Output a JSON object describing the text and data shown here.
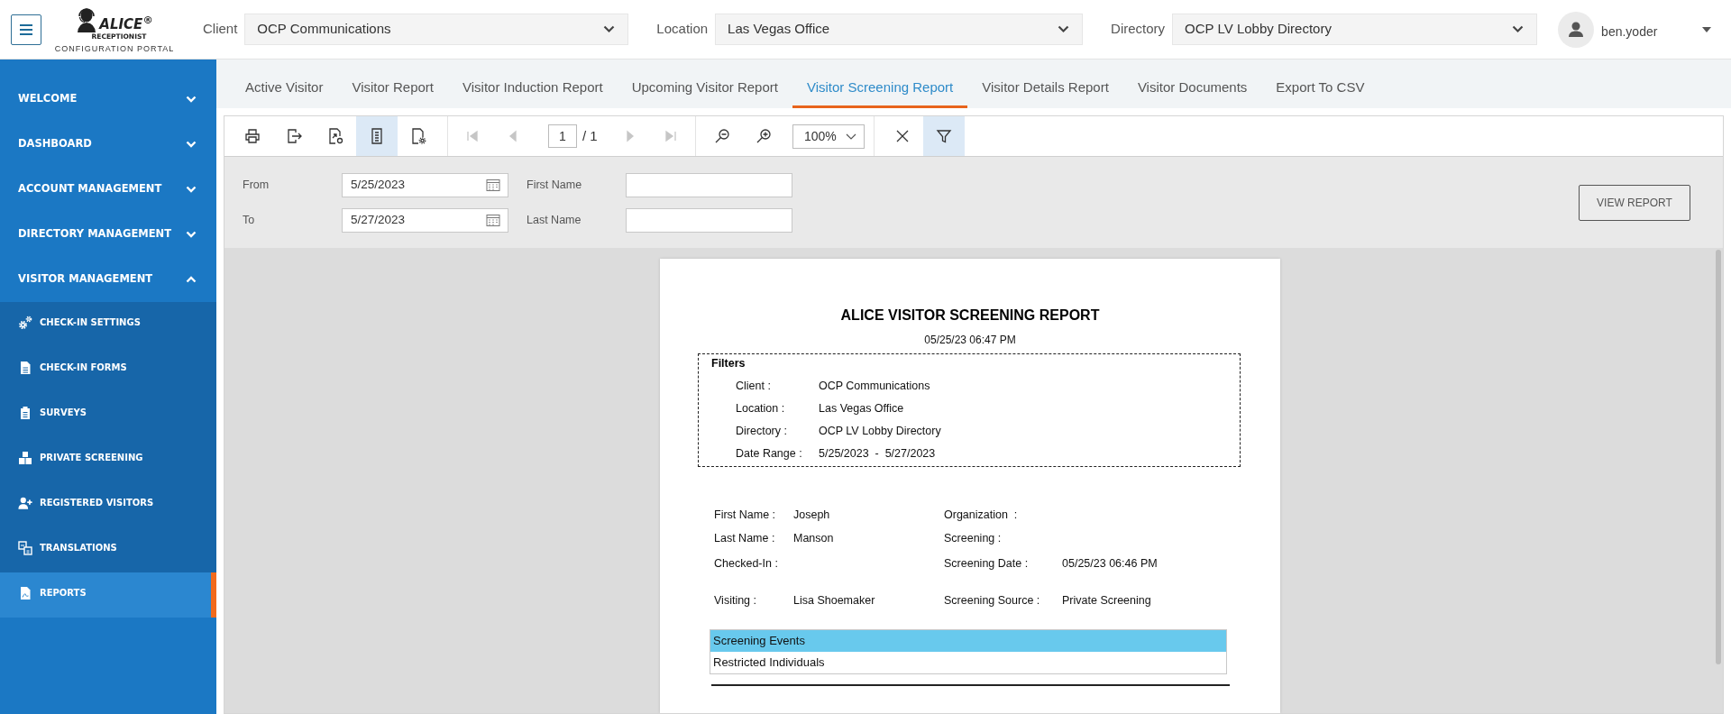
{
  "header": {
    "logo": {
      "wordmark": "ALICE$^{®}$",
      "tagline": "RECEPTIONIST",
      "caption": "CONFIGURATION PORTAL"
    },
    "selectors": [
      {
        "label": "Client",
        "value": "OCP Communications"
      },
      {
        "label": "Location",
        "value": "Las Vegas Office"
      },
      {
        "label": "Directory",
        "value": "OCP LV Lobby Directory"
      }
    ],
    "user": {
      "name": "ben.yoder"
    }
  },
  "sidebar": {
    "items": [
      {
        "label": "WELCOME",
        "expanded": false
      },
      {
        "label": "DASHBOARD",
        "expanded": false
      },
      {
        "label": "ACCOUNT MANAGEMENT",
        "expanded": false
      },
      {
        "label": "DIRECTORY MANAGEMENT",
        "expanded": false
      },
      {
        "label": "VISITOR MANAGEMENT",
        "expanded": true,
        "children": [
          {
            "label": "CHECK-IN SETTINGS",
            "selected": false
          },
          {
            "label": "CHECK-IN FORMS",
            "selected": false
          },
          {
            "label": "SURVEYS",
            "selected": false
          },
          {
            "label": "PRIVATE SCREENING",
            "selected": false
          },
          {
            "label": "REGISTERED VISITORS",
            "selected": false
          },
          {
            "label": "TRANSLATIONS",
            "selected": false
          },
          {
            "label": "REPORTS",
            "selected": true
          }
        ]
      }
    ]
  },
  "tabs": [
    {
      "label": "Active Visitor",
      "selected": false
    },
    {
      "label": "Visitor Report",
      "selected": false
    },
    {
      "label": "Visitor Induction Report",
      "selected": false
    },
    {
      "label": "Upcoming Visitor Report",
      "selected": false
    },
    {
      "label": "Visitor Screening Report",
      "selected": true
    },
    {
      "label": "Visitor Details Report",
      "selected": false
    },
    {
      "label": "Visitor Documents",
      "selected": false
    },
    {
      "label": "Export To CSV",
      "selected": false
    }
  ],
  "toolbar": {
    "groups": [
      {
        "items": [
          {
            "kind": "button",
            "on": false,
            "disabled": false
          },
          {
            "kind": "button",
            "on": false,
            "disabled": false
          },
          {
            "kind": "button",
            "on": false,
            "disabled": false
          },
          {
            "kind": "button",
            "on": true,
            "disabled": false
          },
          {
            "kind": "button",
            "on": false,
            "disabled": false
          }
        ]
      },
      {
        "items": [
          {
            "kind": "button",
            "on": false,
            "disabled": true
          },
          {
            "kind": "button",
            "on": false,
            "disabled": true
          },
          {
            "kind": "page",
            "value": "1",
            "total": "/ 1"
          },
          {
            "kind": "button",
            "on": false,
            "disabled": true
          },
          {
            "kind": "button",
            "on": false,
            "disabled": true
          }
        ]
      },
      {
        "items": [
          {
            "kind": "button",
            "on": false,
            "disabled": false
          },
          {
            "kind": "button",
            "on": false,
            "disabled": false
          },
          {
            "kind": "zoom",
            "value": "100%"
          }
        ]
      },
      {
        "items": [
          {
            "kind": "button",
            "on": false,
            "disabled": false
          },
          {
            "kind": "button",
            "on": true,
            "disabled": false
          }
        ]
      }
    ]
  },
  "parameters": {
    "columns": [
      {
        "fields": [
          {
            "kind": "date",
            "label": "From",
            "value": "5/25/2023"
          },
          {
            "kind": "date",
            "label": "To",
            "value": "5/27/2023"
          }
        ]
      },
      {
        "fields": [
          {
            "kind": "text",
            "label": "First Name"
          },
          {
            "kind": "text",
            "label": "Last Name"
          }
        ]
      }
    ],
    "button": "VIEW REPORT"
  },
  "report": {
    "title": "ALICE VISITOR SCREENING REPORT",
    "timestamp": "05/25/23 06:47 PM",
    "filters": {
      "heading": "Filters",
      "rows": [
        {
          "label": "Client :",
          "value": "OCP Communications"
        },
        {
          "label": "Location :",
          "value": "Las Vegas Office"
        },
        {
          "label": "Directory :",
          "value": "OCP LV Lobby Directory"
        },
        {
          "label": "Date Range :",
          "value": "5/25/2023  -  5/27/2023"
        }
      ]
    },
    "details": {
      "rows": [
        {
          "cells": [
            {
              "label": "First Name :",
              "value": "Joseph"
            },
            {
              "label": "Organization  :"
            }
          ]
        },
        {
          "cells": [
            {
              "label": "Last Name :",
              "value": "Manson"
            },
            {
              "label": "Screening :"
            }
          ]
        },
        {
          "cells": [
            {
              "label": "Checked-In :"
            },
            {
              "label": "Screening Date :",
              "value": "05/25/23 06:46 PM"
            }
          ]
        },
        {
          "cells": [
            {
              "label": "Visiting :",
              "value": "Lisa Shoemaker"
            },
            {
              "label": "Screening Source :",
              "value": "Private Screening"
            }
          ]
        }
      ]
    },
    "events_table": {
      "rows": [
        {
          "kind": "header",
          "label": "Screening Events"
        },
        {
          "kind": "row",
          "label": "Restricted Individuals"
        }
      ]
    }
  }
}
